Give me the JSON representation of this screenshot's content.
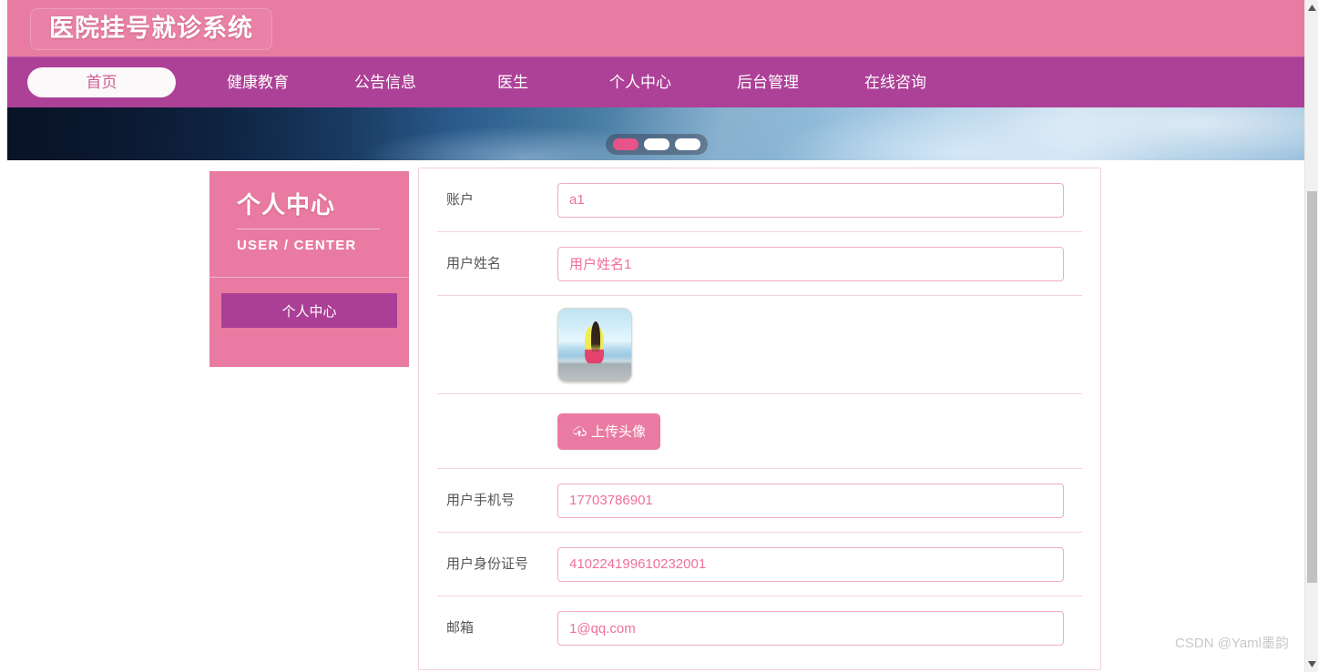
{
  "header": {
    "brand": "医院挂号就诊系统"
  },
  "nav": {
    "items": [
      {
        "label": "首页",
        "active": true
      },
      {
        "label": "健康教育",
        "active": false
      },
      {
        "label": "公告信息",
        "active": false
      },
      {
        "label": "医生",
        "active": false
      },
      {
        "label": "个人中心",
        "active": false
      },
      {
        "label": "后台管理",
        "active": false
      },
      {
        "label": "在线咨询",
        "active": false
      }
    ]
  },
  "banner": {
    "dots": [
      {
        "active": true
      },
      {
        "active": false
      },
      {
        "active": false
      }
    ]
  },
  "sidebar": {
    "title": "个人中心",
    "subtitle": "USER / CENTER",
    "menu": [
      {
        "label": "个人中心",
        "active": true
      }
    ]
  },
  "form": {
    "fields": [
      {
        "label": "账户",
        "value": "a1",
        "placeholder": "账户"
      },
      {
        "label": "用户姓名",
        "value": "用户姓名1",
        "placeholder": "用户姓名"
      }
    ],
    "avatar": {
      "label": "",
      "alt": "用户头像"
    },
    "upload": {
      "label": "上传头像",
      "icon": "cloud-upload-icon"
    },
    "fields2": [
      {
        "label": "用户手机号",
        "value": "17703786901",
        "placeholder": "用户手机号"
      },
      {
        "label": "用户身份证号",
        "value": "410224199610232001",
        "placeholder": "用户身份证号"
      },
      {
        "label": "邮箱",
        "value": "1@qq.com",
        "placeholder": "邮箱"
      }
    ]
  },
  "watermark": {
    "line1": "CSDN @Yaml墨韵"
  },
  "colors": {
    "header_pink": "#e87ba1",
    "nav_purple": "#ad4097",
    "accent_pink": "#e97ba2",
    "input_border": "#f2a9c6",
    "input_text": "#ef6f9e",
    "menu_active": "#ab3f96"
  }
}
